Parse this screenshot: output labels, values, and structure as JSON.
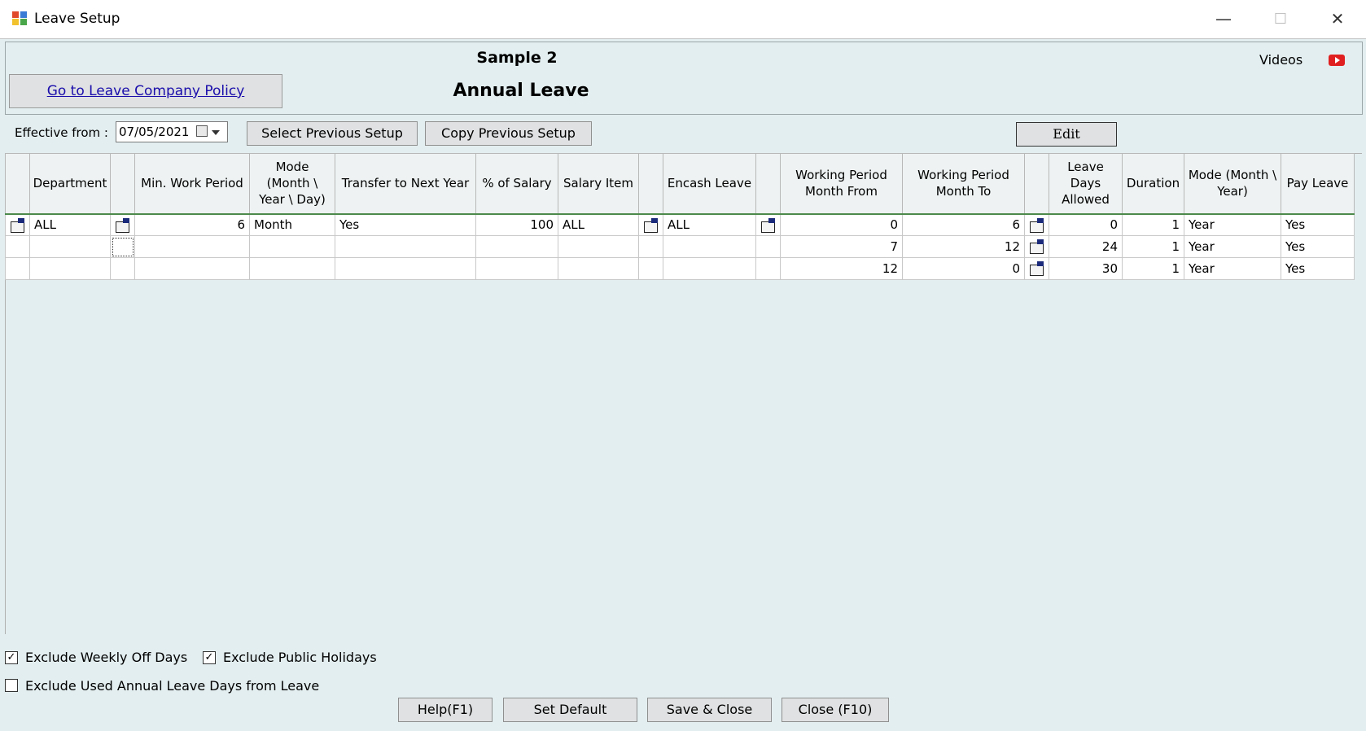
{
  "window": {
    "title": "Leave Setup",
    "minimize": "—",
    "maximize": "☐",
    "close": "✕"
  },
  "header": {
    "company": "Sample 2",
    "leave_type": "Annual Leave",
    "policy_link": "Go to Leave Company Policy",
    "videos_label": "Videos"
  },
  "effective": {
    "label": "Effective from :",
    "date": "07/05/2021"
  },
  "toolbar": {
    "select_previous": "Select Previous Setup",
    "copy_previous": "Copy Previous Setup",
    "edit": "Edit"
  },
  "grid": {
    "headers": {
      "department": "Department",
      "min_work_period": "Min. Work Period",
      "mode": "Mode (Month \\ Year \\ Day)",
      "transfer": "Transfer to Next Year",
      "pct_salary": "% of Salary",
      "salary_item": "Salary Item",
      "encash": "Encash Leave",
      "wp_from": "Working Period Month From",
      "wp_to": "Working Period Month To",
      "leave_days": "Leave Days Allowed",
      "duration": "Duration",
      "mode_my": "Mode (Month \\ Year)",
      "pay_leave": "Pay Leave"
    },
    "main_row": {
      "department": "ALL",
      "min_work_period": "6",
      "mode": "Month",
      "transfer": "Yes",
      "pct_salary": "100",
      "salary_item": "ALL",
      "encash": "ALL"
    },
    "slabs": [
      {
        "from": "0",
        "to": "6",
        "days": "0",
        "duration": "1",
        "mode": "Year",
        "pay": "Yes"
      },
      {
        "from": "7",
        "to": "12",
        "days": "24",
        "duration": "1",
        "mode": "Year",
        "pay": "Yes"
      },
      {
        "from": "12",
        "to": "0",
        "days": "30",
        "duration": "1",
        "mode": "Year",
        "pay": "Yes"
      }
    ]
  },
  "options": {
    "exclude_weekly_off": {
      "label": "Exclude Weekly Off Days",
      "checked": true
    },
    "exclude_public_holidays": {
      "label": "Exclude Public Holidays",
      "checked": true
    },
    "exclude_used_annual": {
      "label": "Exclude Used Annual Leave Days from Leave",
      "checked": false
    }
  },
  "footer": {
    "help": "Help(F1)",
    "set_default": "Set Default",
    "save_close": "Save & Close",
    "close": "Close (F10)"
  }
}
